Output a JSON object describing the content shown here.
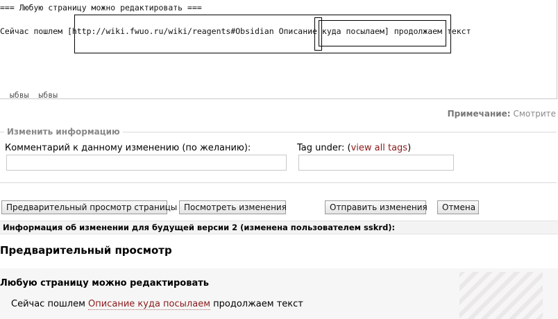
{
  "editor": {
    "line1": "=== Любую страницу можно редактировать ===",
    "line2_prefix": "Сейчас пошлем ",
    "line2_url": "[http://wiki.fwuo.ru/wiki/reagents#Obsidian ",
    "line2_text": "Описание куда посылаем]",
    "line2_suffix": " продолжаем текст",
    "line3": "  ыбвы  ыбвы"
  },
  "note": {
    "label": "Примечание:",
    "text": "Смотрите"
  },
  "info": {
    "legend": "Изменить информацию",
    "comment_label": "Комментарий к данному изменению (по желанию):",
    "comment_value": "",
    "tag_label": "Tag under: (",
    "tag_link": "view all tags",
    "tag_close": ")",
    "tag_value": ""
  },
  "buttons": {
    "preview": "Предварительный просмотр страницы",
    "diff": "Посмотреть изменения",
    "save": "Отправить изменения",
    "cancel": "Отмена"
  },
  "change_info": "Информация об изменении для будущей версии 2 (изменена пользователем sskrd):",
  "preview": {
    "title": "Предварительный просмотр",
    "heading": "Любую страницу можно редактировать",
    "text_prefix": "Сейчас пошлем ",
    "link": "Описание куда посылаем",
    "text_suffix": " продолжаем текст"
  },
  "colors": {
    "link": "#8b1a1a",
    "muted": "#888888",
    "border": "#c8c8c8"
  }
}
